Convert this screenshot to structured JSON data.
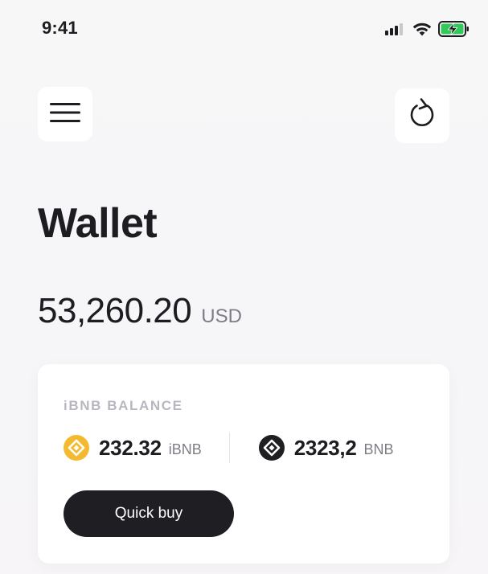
{
  "status_bar": {
    "time": "9:41",
    "icons": [
      "cellular-signal-icon",
      "wifi-icon",
      "battery-charging-icon"
    ]
  },
  "header": {
    "menu_icon": "hamburger-menu-icon",
    "refresh_icon": "refresh-icon"
  },
  "page": {
    "title": "Wallet"
  },
  "total_balance": {
    "value": "53,260.20",
    "unit": "USD"
  },
  "balance_card": {
    "label": "iBNB BALANCE",
    "items": [
      {
        "amount": "232.32",
        "unit": "iBNB",
        "icon": "ibnb-coin-icon",
        "icon_color": "#f3ba2f"
      },
      {
        "amount": "2323,2",
        "unit": "BNB",
        "icon": "bnb-coin-icon",
        "icon_color": "#1f1f23"
      }
    ],
    "quick_buy_label": "Quick buy"
  },
  "colors": {
    "background": "#f7f7f8",
    "card": "#ffffff",
    "text_primary": "#1d1d21",
    "text_muted": "#7d7d85",
    "label": "#b7b7c0",
    "button_dark": "#1f1f23",
    "battery_green": "#34c759",
    "coin_yellow": "#f3ba2f"
  }
}
